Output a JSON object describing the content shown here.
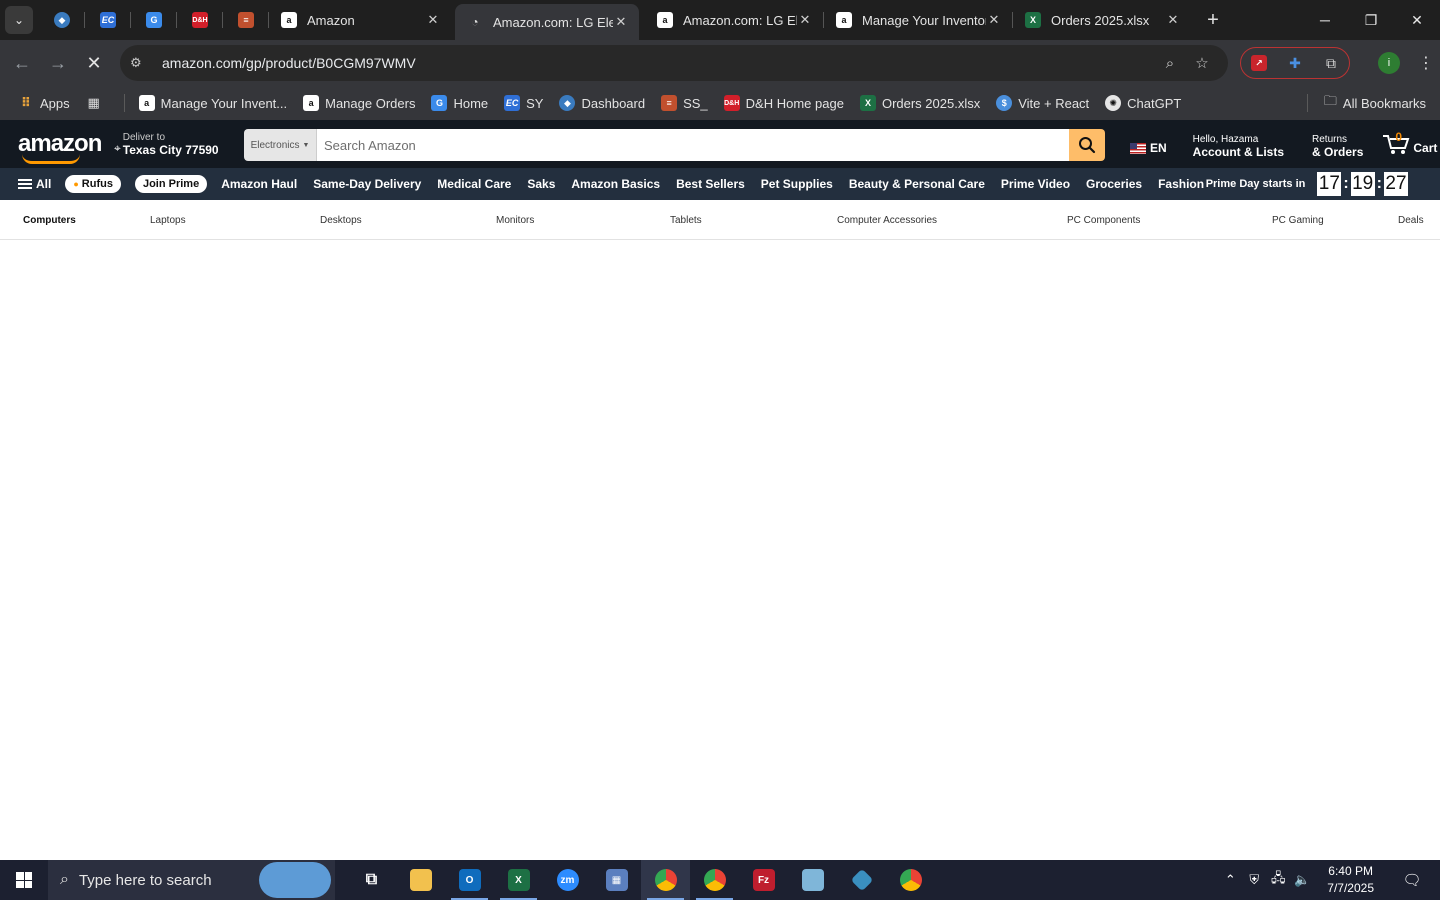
{
  "browser": {
    "tabs": [
      {
        "label": "Amazon",
        "active": false
      },
      {
        "label": "Amazon.com: LG Electronics",
        "active": true
      },
      {
        "label": "Amazon.com: LG Electronics",
        "active": false
      },
      {
        "label": "Manage Your Inventory",
        "active": false
      },
      {
        "label": "Orders 2025.xlsx",
        "active": false
      }
    ],
    "url": "amazon.com/gp/product/B0CGM97WMV",
    "bookmarks": [
      {
        "label": "Apps"
      },
      {
        "label": "Manage Your Invent..."
      },
      {
        "label": "Manage Orders"
      },
      {
        "label": "Home"
      },
      {
        "label": "SY"
      },
      {
        "label": "Dashboard"
      },
      {
        "label": "SS_"
      },
      {
        "label": "D&H Home page"
      },
      {
        "label": "Orders 2025.xlsx"
      },
      {
        "label": "Vite + React"
      },
      {
        "label": "ChatGPT"
      }
    ],
    "all_bookmarks": "All Bookmarks",
    "profile_initial": "i"
  },
  "amazon": {
    "deliver_line1": "Deliver to",
    "deliver_line2": "Texas City 77590",
    "search_category": "Electronics",
    "search_placeholder": "Search Amazon",
    "language": "EN",
    "account_line1": "Hello, Hazama",
    "account_line2": "Account & Lists",
    "returns_line1": "Returns",
    "returns_line2": "& Orders",
    "cart_count": "0",
    "cart_label": "Cart",
    "nav": {
      "all": "All",
      "rufus": "Rufus",
      "join_prime": "Join Prime",
      "links": [
        "Amazon Haul",
        "Same-Day Delivery",
        "Medical Care",
        "Saks",
        "Amazon Basics",
        "Best Sellers",
        "Pet Supplies",
        "Beauty & Personal Care",
        "Prime Video",
        "Groceries",
        "Fashion"
      ],
      "prime_day_label": "Prime Day starts in",
      "timer": [
        "17",
        "19",
        "27"
      ]
    },
    "subnav": [
      "Computers",
      "Laptops",
      "Desktops",
      "Monitors",
      "Tablets",
      "Computer Accessories",
      "PC Components",
      "PC Gaming",
      "Deals"
    ]
  },
  "taskbar": {
    "search_placeholder": "Type here to search",
    "time": "6:40 PM",
    "date": "7/7/2025"
  },
  "colors": {
    "amazon_dark": "#131921",
    "amazon_nav": "#232f3e",
    "amazon_orange": "#febd69",
    "chrome_dark": "#1f1f1f"
  }
}
